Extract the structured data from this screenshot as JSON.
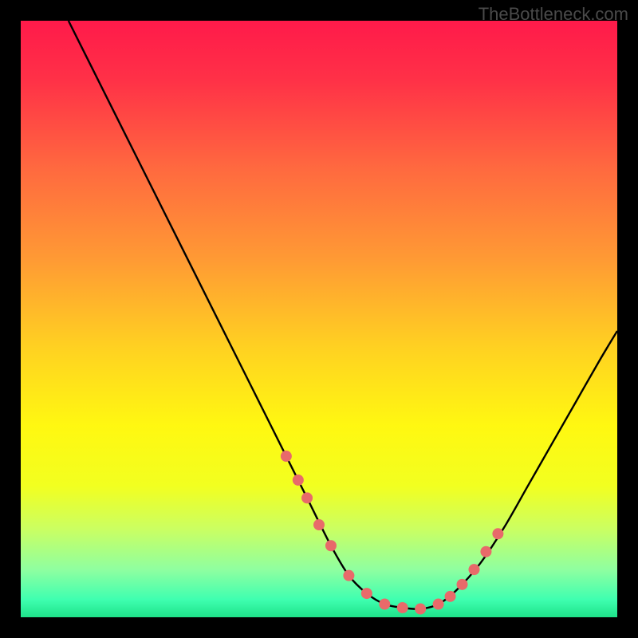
{
  "watermark": "TheBottleneck.com",
  "chart_data": {
    "type": "line",
    "title": "",
    "xlabel": "",
    "ylabel": "",
    "xlim": [
      0,
      100
    ],
    "ylim": [
      0,
      100
    ],
    "grid": false,
    "legend": false,
    "gradient_stops": [
      {
        "offset": 0.0,
        "color": "#ff1a4a"
      },
      {
        "offset": 0.1,
        "color": "#ff3147"
      },
      {
        "offset": 0.25,
        "color": "#ff6a3f"
      },
      {
        "offset": 0.4,
        "color": "#ff9a34"
      },
      {
        "offset": 0.55,
        "color": "#ffd221"
      },
      {
        "offset": 0.68,
        "color": "#fff811"
      },
      {
        "offset": 0.78,
        "color": "#f2ff20"
      },
      {
        "offset": 0.85,
        "color": "#ccff60"
      },
      {
        "offset": 0.92,
        "color": "#8fffa0"
      },
      {
        "offset": 0.97,
        "color": "#3fffb0"
      },
      {
        "offset": 1.0,
        "color": "#1fe38a"
      }
    ],
    "series": [
      {
        "name": "bottleneck-curve",
        "color": "#000000",
        "x": [
          8,
          12,
          16,
          20,
          24,
          28,
          32,
          36,
          40,
          44,
          48,
          52,
          55,
          58,
          61,
          64,
          67,
          70,
          73,
          77,
          81,
          85,
          89,
          93,
          97,
          100
        ],
        "y": [
          100,
          92,
          84,
          76,
          68,
          60,
          52,
          44,
          36,
          28,
          20,
          12,
          7,
          4,
          2.2,
          1.6,
          1.4,
          2.2,
          4.5,
          9,
          15,
          22,
          29,
          36,
          43,
          48
        ]
      }
    ],
    "markers": {
      "name": "highlight-points",
      "color": "#e86a6a",
      "radius": 7,
      "x": [
        44.5,
        46.5,
        48,
        50,
        52,
        55,
        58,
        61,
        64,
        67,
        70,
        72,
        74,
        76,
        78,
        80
      ],
      "y": [
        27,
        23,
        20,
        15.5,
        12,
        7,
        4,
        2.2,
        1.6,
        1.4,
        2.2,
        3.5,
        5.5,
        8,
        11,
        14
      ]
    }
  }
}
